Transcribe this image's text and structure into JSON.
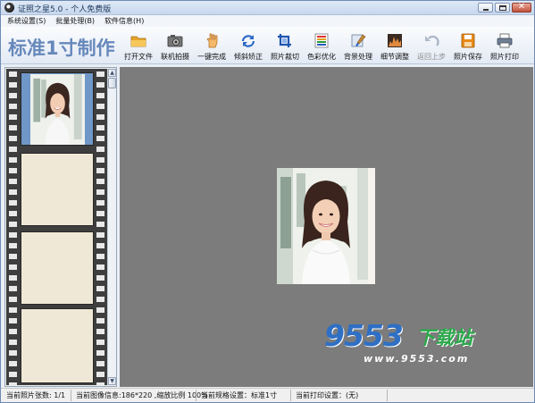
{
  "window": {
    "title": "证照之星5.0 - 个人免费版"
  },
  "menu": [
    {
      "label": "系统设置(S)"
    },
    {
      "label": "批量处理(B)"
    },
    {
      "label": "软件信息(H)"
    }
  ],
  "brand": "标准1寸制作",
  "toolbar": [
    {
      "label": "打开文件",
      "icon": "folder-icon",
      "enabled": true
    },
    {
      "label": "联机拍摄",
      "icon": "camera-icon",
      "enabled": true
    },
    {
      "label": "一键完成",
      "icon": "hand-icon",
      "enabled": true
    },
    {
      "label": "倾斜矫正",
      "icon": "rotate-icon",
      "enabled": true
    },
    {
      "label": "照片裁切",
      "icon": "crop-icon",
      "enabled": true
    },
    {
      "label": "色彩优化",
      "icon": "color-bars-icon",
      "enabled": true
    },
    {
      "label": "背景处理",
      "icon": "brush-icon",
      "enabled": true
    },
    {
      "label": "细节调整",
      "icon": "levels-icon",
      "enabled": true
    },
    {
      "label": "返回上步",
      "icon": "undo-icon",
      "enabled": false
    },
    {
      "label": "照片保存",
      "icon": "save-icon",
      "enabled": true
    },
    {
      "label": "照片打印",
      "icon": "printer-icon",
      "enabled": true
    }
  ],
  "watermark": {
    "number": "9553",
    "cn": "下载站",
    "url": "www.9553.com"
  },
  "status": {
    "count": "当前照片张数: 1/1",
    "info": "当前图像信息:186*220 ,缩放比例 100%",
    "spec": "当前规格设置：标准1寸",
    "print": "当前打印设置：(无)"
  },
  "colors": {
    "brand": "#6688bb",
    "workspace": "#7c7c7c",
    "watermark_blue": "#2f6fc4",
    "watermark_green": "#2aa84a"
  }
}
